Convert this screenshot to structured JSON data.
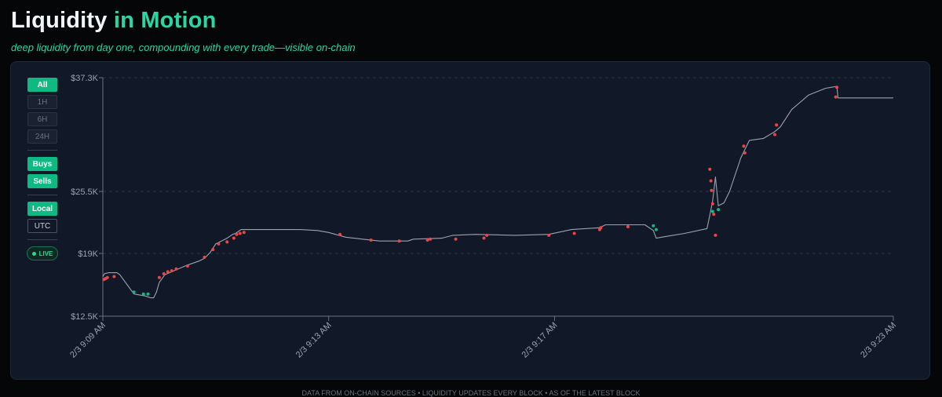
{
  "header": {
    "title_main": "Liquidity",
    "title_accent": "in Motion",
    "subtitle": "deep liquidity from day one, compounding with every trade—visible on-chain"
  },
  "controls": {
    "ranges": [
      {
        "label": "All",
        "active": true
      },
      {
        "label": "1H",
        "active": false
      },
      {
        "label": "6H",
        "active": false
      },
      {
        "label": "24H",
        "active": false
      }
    ],
    "filters": [
      {
        "label": "Buys",
        "active": true
      },
      {
        "label": "Sells",
        "active": true
      }
    ],
    "timezones": [
      {
        "label": "Local",
        "active": true
      },
      {
        "label": "UTC",
        "active": false
      }
    ],
    "live_label": "LIVE"
  },
  "colors": {
    "accent": "#2dd4a4",
    "buy": "#10b981",
    "sell": "#ef4444",
    "line": "#9ca3af",
    "panel": "#111827"
  },
  "chart_data": {
    "type": "line",
    "title": "",
    "xlabel": "",
    "ylabel": "",
    "x_ticks": [
      "2/3 9:09 AM",
      "2/3 9:13 AM",
      "2/3 9:17 AM",
      "2/3 9:23 AM"
    ],
    "x_tick_minutes": [
      0,
      4,
      8,
      14
    ],
    "xlim_minutes": [
      0,
      14
    ],
    "y_ticks": [
      {
        "value": 12500,
        "label": "$12.5K"
      },
      {
        "value": 19000,
        "label": "$19K"
      },
      {
        "value": 25500,
        "label": "$25.5K"
      },
      {
        "value": 37300,
        "label": "$37.3K"
      }
    ],
    "ylim": [
      12500,
      37300
    ],
    "grid": "horizontal dashed",
    "series": [
      {
        "type": "line",
        "points": [
          [
            0.0,
            16.6
          ],
          [
            0.03,
            16.9
          ],
          [
            0.1,
            17.0
          ],
          [
            0.25,
            17.0
          ],
          [
            0.3,
            16.8
          ],
          [
            0.45,
            15.6
          ],
          [
            0.55,
            14.8
          ],
          [
            0.75,
            14.6
          ],
          [
            0.85,
            14.4
          ],
          [
            0.9,
            14.4
          ],
          [
            0.95,
            15.0
          ],
          [
            1.0,
            16.0
          ],
          [
            1.1,
            16.8
          ],
          [
            1.3,
            17.3
          ],
          [
            1.5,
            17.8
          ],
          [
            1.7,
            18.2
          ],
          [
            1.8,
            18.5
          ],
          [
            1.9,
            19.1
          ],
          [
            2.0,
            20.0
          ],
          [
            2.1,
            20.3
          ],
          [
            2.2,
            20.6
          ],
          [
            2.3,
            21.0
          ],
          [
            2.35,
            21.1
          ],
          [
            2.4,
            21.3
          ],
          [
            2.45,
            21.5
          ],
          [
            3.5,
            21.5
          ],
          [
            3.8,
            21.4
          ],
          [
            4.0,
            21.2
          ],
          [
            4.3,
            20.7
          ],
          [
            4.6,
            20.5
          ],
          [
            4.9,
            20.3
          ],
          [
            5.4,
            20.3
          ],
          [
            5.5,
            20.5
          ],
          [
            6.0,
            20.6
          ],
          [
            6.2,
            20.9
          ],
          [
            6.6,
            21.0
          ],
          [
            7.3,
            20.9
          ],
          [
            7.9,
            21.0
          ],
          [
            8.3,
            21.5
          ],
          [
            8.8,
            21.7
          ],
          [
            8.9,
            22.0
          ],
          [
            9.6,
            22.0
          ],
          [
            9.75,
            21.4
          ],
          [
            9.8,
            20.6
          ],
          [
            10.0,
            20.8
          ],
          [
            10.3,
            21.1
          ],
          [
            10.7,
            21.6
          ],
          [
            10.75,
            23.0
          ],
          [
            10.8,
            24.5
          ],
          [
            10.85,
            27.0
          ],
          [
            10.9,
            24.0
          ],
          [
            11.0,
            24.3
          ],
          [
            11.1,
            25.5
          ],
          [
            11.3,
            29.0
          ],
          [
            11.45,
            30.8
          ],
          [
            11.7,
            31.0
          ],
          [
            11.9,
            31.7
          ],
          [
            12.0,
            32.2
          ],
          [
            12.2,
            34.0
          ],
          [
            12.5,
            35.5
          ],
          [
            12.8,
            36.2
          ],
          [
            13.0,
            36.4
          ],
          [
            13.02,
            35.2
          ],
          [
            14.0,
            35.2
          ]
        ]
      },
      {
        "name": "",
        "type": "sells",
        "points": [
          [
            0.02,
            16.3
          ],
          [
            0.05,
            16.4
          ],
          [
            0.08,
            16.5
          ],
          [
            0.2,
            16.6
          ],
          [
            1.0,
            16.5
          ],
          [
            1.08,
            16.9
          ],
          [
            1.15,
            17.1
          ],
          [
            1.22,
            17.2
          ],
          [
            1.3,
            17.4
          ],
          [
            1.5,
            17.7
          ],
          [
            1.8,
            18.6
          ],
          [
            1.95,
            19.4
          ],
          [
            2.05,
            20.0
          ],
          [
            2.2,
            20.2
          ],
          [
            2.32,
            20.6
          ],
          [
            2.37,
            21.0
          ],
          [
            2.43,
            21.1
          ],
          [
            2.5,
            21.2
          ],
          [
            4.2,
            21.0
          ],
          [
            4.75,
            20.4
          ],
          [
            5.25,
            20.3
          ],
          [
            5.75,
            20.4
          ],
          [
            5.8,
            20.5
          ],
          [
            6.25,
            20.5
          ],
          [
            6.75,
            20.6
          ],
          [
            6.8,
            20.9
          ],
          [
            7.9,
            20.9
          ],
          [
            8.35,
            21.1
          ],
          [
            8.8,
            21.5
          ],
          [
            8.82,
            21.7
          ],
          [
            9.3,
            21.8
          ],
          [
            10.75,
            27.8
          ],
          [
            10.77,
            26.6
          ],
          [
            10.78,
            25.6
          ],
          [
            10.8,
            24.2
          ],
          [
            10.82,
            23.1
          ],
          [
            10.85,
            20.9
          ],
          [
            11.35,
            30.2
          ],
          [
            11.37,
            29.5
          ],
          [
            11.9,
            31.4
          ],
          [
            11.93,
            32.4
          ],
          [
            12.98,
            35.3
          ],
          [
            13.0,
            36.3
          ]
        ]
      },
      {
        "name": "",
        "type": "buys",
        "points": [
          [
            0.55,
            15.0
          ],
          [
            0.72,
            14.8
          ],
          [
            0.8,
            14.8
          ],
          [
            9.75,
            21.9
          ],
          [
            9.8,
            21.5
          ],
          [
            10.8,
            23.4
          ],
          [
            10.9,
            23.6
          ]
        ]
      }
    ],
    "y_unit": "$K"
  },
  "footer": {
    "text": "DATA FROM ON-CHAIN SOURCES • LIQUIDITY UPDATES EVERY BLOCK • AS OF THE LATEST BLOCK"
  }
}
